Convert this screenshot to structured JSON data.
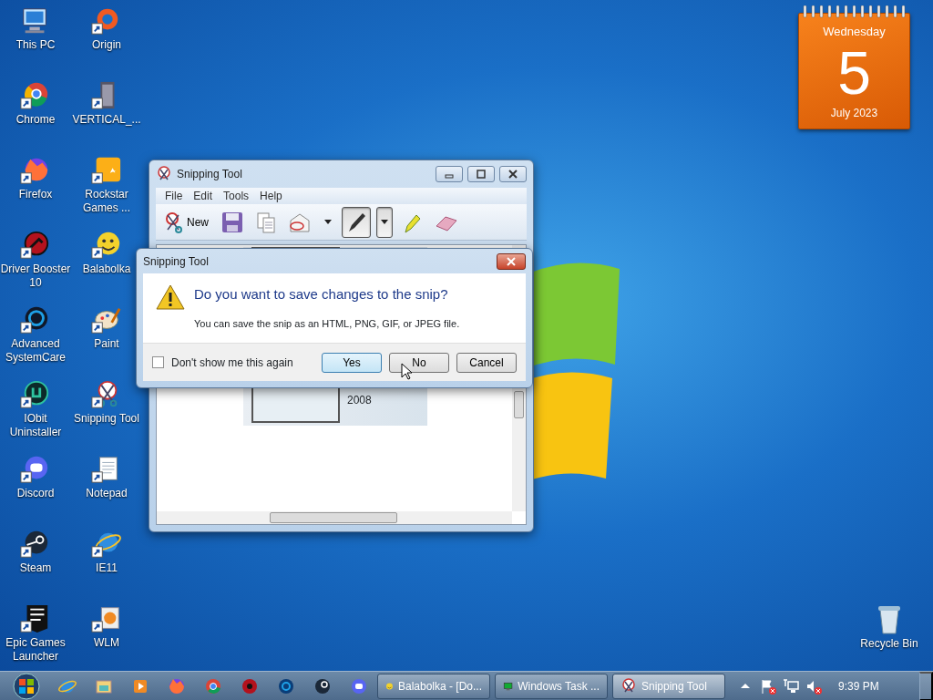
{
  "desktop_icons": [
    {
      "label": "This PC"
    },
    {
      "label": "Origin"
    },
    {
      "label": "Chrome"
    },
    {
      "label": "VERTICAL_..."
    },
    {
      "label": "Firefox"
    },
    {
      "label": "Rockstar Games ..."
    },
    {
      "label": "Driver Booster 10"
    },
    {
      "label": "Balabolka"
    },
    {
      "label": "Advanced SystemCare"
    },
    {
      "label": "Paint"
    },
    {
      "label": "IObit Uninstaller"
    },
    {
      "label": "Snipping Tool"
    },
    {
      "label": "Discord"
    },
    {
      "label": "Notepad"
    },
    {
      "label": "Steam"
    },
    {
      "label": "IE11"
    },
    {
      "label": "Epic Games Launcher"
    },
    {
      "label": "WLM"
    }
  ],
  "calendar": {
    "weekday": "Wednesday",
    "day": "5",
    "month_year": "July 2023"
  },
  "snipping_window": {
    "title": "Snipping Tool",
    "menu": [
      "File",
      "Edit",
      "Tools",
      "Help"
    ],
    "tools": [
      {
        "kind": "new",
        "label": "New",
        "selected": false
      },
      {
        "kind": "save",
        "selected": false
      },
      {
        "kind": "copy",
        "selected": false
      },
      {
        "kind": "send",
        "selected": false
      },
      {
        "kind": "pen",
        "selected": true
      },
      {
        "kind": "highlighter",
        "selected": false
      },
      {
        "kind": "eraser",
        "selected": false
      }
    ],
    "snip": {
      "caption": "2008"
    }
  },
  "dialog": {
    "title": "Snipping Tool",
    "heading": "Do you want to save changes to the snip?",
    "message": "You can save the snip as an HTML, PNG, GIF, or JPEG file.",
    "checkbox": {
      "label": "Don't show me this again",
      "checked": false
    },
    "buttons": [
      {
        "label": "Yes",
        "default": true
      },
      {
        "label": "No",
        "default": false
      },
      {
        "label": "Cancel",
        "default": false
      }
    ]
  },
  "recycle_bin": {
    "label": "Recycle Bin"
  },
  "taskbar": {
    "windows": [
      {
        "label": "Balabolka - [Do...",
        "selected": false
      },
      {
        "label": "Windows Task ...",
        "selected": false
      },
      {
        "label": "Snipping Tool",
        "selected": true
      }
    ],
    "clock": "9:39 PM"
  }
}
